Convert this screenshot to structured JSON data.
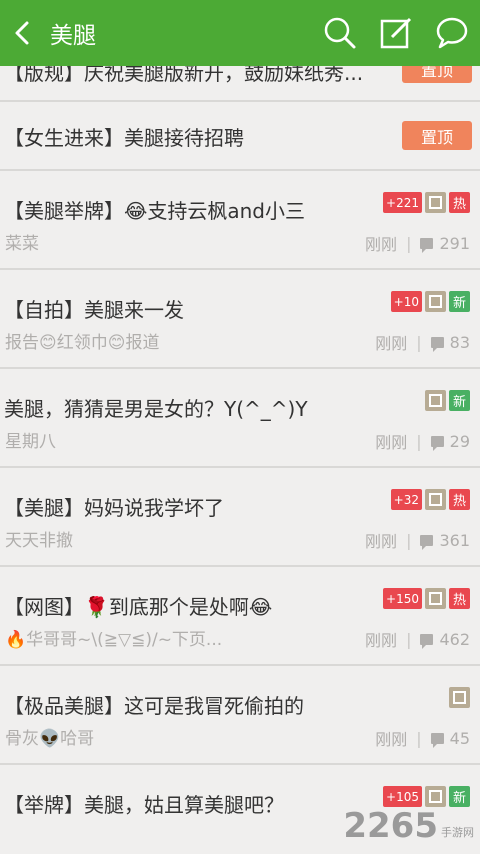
{
  "header": {
    "title": "美腿",
    "icons": [
      "back-arrow-icon",
      "search-icon",
      "edit-icon",
      "chat-bubble-icon"
    ]
  },
  "pinned": [
    {
      "title": "【版规】庆祝美腿版新开，鼓励妹纸秀...",
      "button": "置顶"
    },
    {
      "title": "【女生进来】美腿接待招聘",
      "button": "置顶"
    }
  ],
  "posts": [
    {
      "title": "【美腿举牌】😂支持云枫and小三",
      "author": "菜菜",
      "count": "+221",
      "hot": "热",
      "time": "刚刚",
      "comments": "291"
    },
    {
      "title": "【自拍】美腿来一发",
      "author": "报告😊红领巾😊报道",
      "count": "+10",
      "new": "新",
      "time": "刚刚",
      "comments": "83"
    },
    {
      "title": "美腿，猜猜是男是女的？Y(^_^)Y",
      "author": "星期八",
      "new": "新",
      "time": "刚刚",
      "comments": "29"
    },
    {
      "title": "【美腿】妈妈说我学坏了",
      "author": "天天非撤",
      "count": "+32",
      "hot": "热",
      "time": "刚刚",
      "comments": "361"
    },
    {
      "title": "【网图】🌹到底那个是处啊😂",
      "author": "🔥华哥哥~\\(≧▽≦)/~下页...",
      "count": "+150",
      "hot": "热",
      "time": "刚刚",
      "comments": "462"
    },
    {
      "title": "【极品美腿】这可是我冒死偷拍的",
      "author": "骨灰👽哈哥",
      "time": "刚刚",
      "comments": "45"
    },
    {
      "title": "【举牌】美腿，姑且算美腿吧？",
      "author": "",
      "count": "+105",
      "new": "新",
      "time": "",
      "comments": ""
    }
  ],
  "watermark": {
    "number": "2265",
    "text": "手游网"
  },
  "colors": {
    "header": "#4caa35",
    "pin_button": "#f0845c",
    "hot": "#e9484f",
    "new": "#49b063",
    "image_badge": "#b7ab94"
  }
}
